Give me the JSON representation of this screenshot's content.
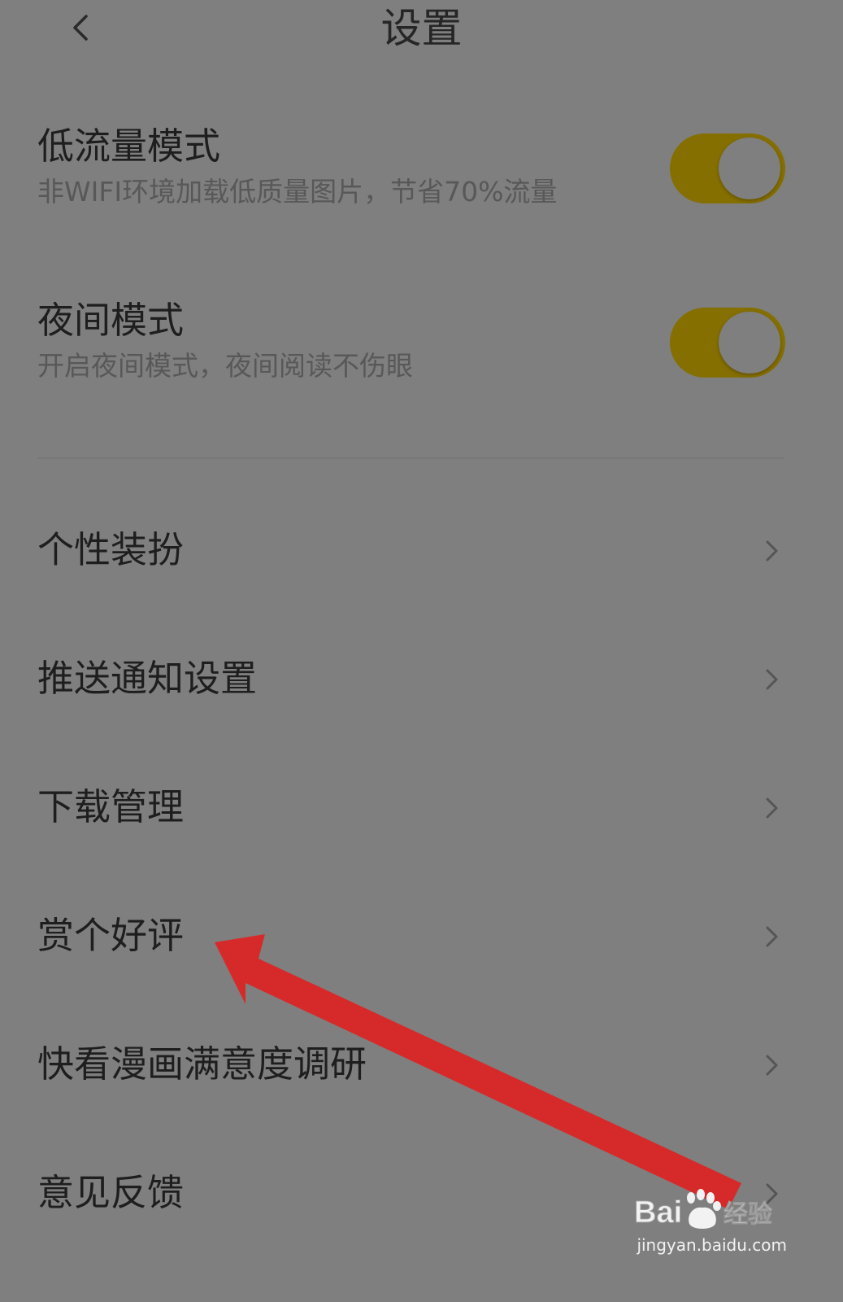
{
  "header": {
    "title": "设置",
    "back_icon": "chevron-left-icon"
  },
  "toggles": [
    {
      "label": "低流量模式",
      "sublabel": "非WIFI环境加载低质量图片，节省70%流量",
      "on": true
    },
    {
      "label": "夜间模式",
      "sublabel": "开启夜间模式，夜间阅读不伤眼",
      "on": true
    }
  ],
  "menu": [
    {
      "label": "个性装扮"
    },
    {
      "label": "推送通知设置"
    },
    {
      "label": "下载管理"
    },
    {
      "label": "赏个好评"
    },
    {
      "label": "快看漫画满意度调研"
    },
    {
      "label": "意见反馈"
    }
  ],
  "colors": {
    "background": "#7f7f7f",
    "toggle_on": "#856f00",
    "arrow": "#d62a2a",
    "text_primary": "#1e1e1e",
    "text_secondary": "#585858"
  },
  "watermark": {
    "logo_text": "Baidu经验",
    "url": "jingyan.baidu.com"
  }
}
